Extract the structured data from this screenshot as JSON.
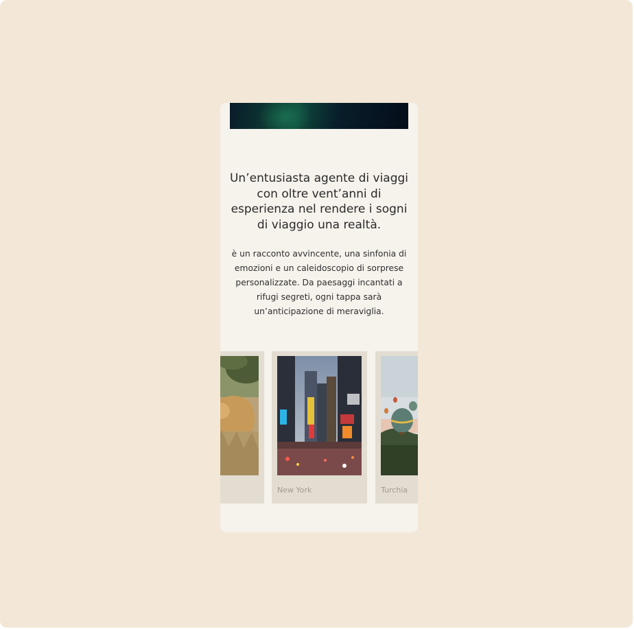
{
  "headline": "Un’entusiasta agente di viaggi con oltre vent’anni di esperienza nel rendere i sogni di viaggio una realtà.",
  "description": "è un racconto avvincente, una sinfonia di emozioni e un caleidoscopio di sorprese personalizzate. Da paesaggi incantati a rifugi segreti, ogni tappa sarà un’anticipazione di meraviglia.",
  "destinations": [
    {
      "caption": "",
      "image": "lioness-photo"
    },
    {
      "caption": "New York",
      "image": "times-square-photo"
    },
    {
      "caption": "Turchia",
      "image": "hot-air-balloons-photo"
    }
  ],
  "colors": {
    "page_background": "#f3e7d7",
    "panel_background": "#f6f2ec",
    "card_background": "#e3ddd1",
    "caption_text": "#a19a8e"
  }
}
